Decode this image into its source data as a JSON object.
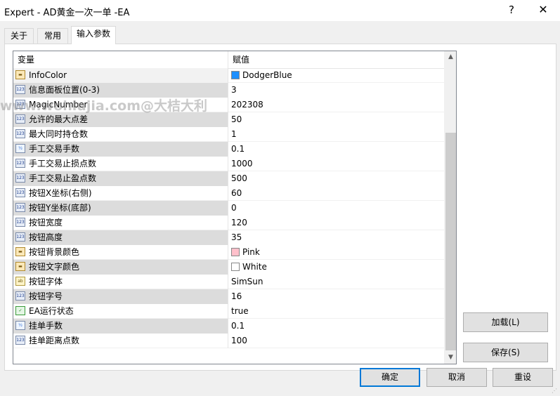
{
  "window": {
    "title": "Expert - AD黄金一次一单 -EA",
    "help_label": "?",
    "close_label": "✕"
  },
  "tabs": [
    {
      "label": "关于"
    },
    {
      "label": "常用"
    },
    {
      "label": "输入参数"
    }
  ],
  "grid": {
    "columns": {
      "name": "变量",
      "value": "赋值"
    },
    "rows": [
      {
        "icon": "color-param-icon",
        "name": "InfoColor",
        "value": "DodgerBlue",
        "swatch": "#1e90ff"
      },
      {
        "icon": "int-param-icon",
        "name": "信息面板位置(0-3)",
        "value": "3"
      },
      {
        "icon": "int-param-icon",
        "name": "MagicNumber",
        "value": "202308"
      },
      {
        "icon": "int-param-icon",
        "name": "允许的最大点差",
        "value": "50"
      },
      {
        "icon": "int-param-icon",
        "name": "最大同时持仓数",
        "value": "1"
      },
      {
        "icon": "double-param-icon",
        "name": "手工交易手数",
        "value": "0.1"
      },
      {
        "icon": "int-param-icon",
        "name": "手工交易止损点数",
        "value": "1000"
      },
      {
        "icon": "int-param-icon",
        "name": "手工交易止盈点数",
        "value": "500"
      },
      {
        "icon": "int-param-icon",
        "name": "按钮X坐标(右侧)",
        "value": "60"
      },
      {
        "icon": "int-param-icon",
        "name": "按钮Y坐标(底部)",
        "value": "0"
      },
      {
        "icon": "int-param-icon",
        "name": "按钮宽度",
        "value": "120"
      },
      {
        "icon": "int-param-icon",
        "name": "按钮高度",
        "value": "35"
      },
      {
        "icon": "color-param-icon",
        "name": "按钮背景颜色",
        "value": "Pink",
        "swatch": "#ffc0cb"
      },
      {
        "icon": "color-param-icon",
        "name": "按钮文字颜色",
        "value": "White",
        "swatch": "#ffffff"
      },
      {
        "icon": "string-param-icon",
        "name": "按钮字体",
        "value": "SimSun"
      },
      {
        "icon": "int-param-icon",
        "name": "按钮字号",
        "value": "16"
      },
      {
        "icon": "bool-param-icon",
        "name": "EA运行状态",
        "value": "true"
      },
      {
        "icon": "double-param-icon",
        "name": "挂单手数",
        "value": "0.1"
      },
      {
        "icon": "int-param-icon",
        "name": "挂单距离点数",
        "value": "100"
      }
    ]
  },
  "side_buttons": {
    "load": "加载(L)",
    "save": "保存(S)"
  },
  "footer_buttons": {
    "ok": "确定",
    "cancel": "取消",
    "reset": "重设"
  },
  "watermark": "www.wohlujia.com@大桔大利"
}
